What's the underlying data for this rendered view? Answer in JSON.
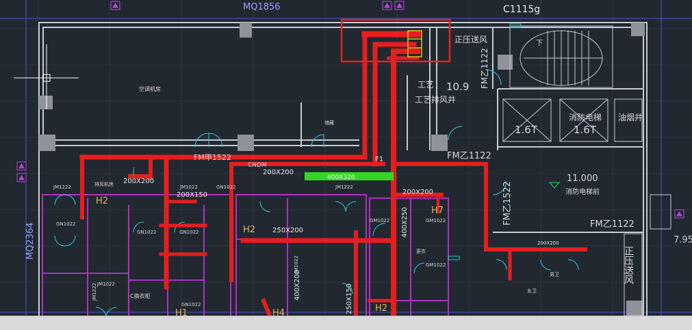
{
  "drawing": {
    "top_labels": {
      "left_dim": "MQ1856",
      "right_ref": "C1115g"
    },
    "left_dim": "MQ2364",
    "right_edge_dim": "7.95",
    "room_labels": {
      "positive_pressure_supply": "正压送风",
      "positive_pressure_supply_v": "正压送风",
      "ac_room": "空调机房",
      "process_exhaust": "工艺排风井",
      "process_exhaust_dim": "10.9",
      "fire_elevator_1": "1.6T",
      "fire_elevator_2": "1.6T",
      "fire_elevator_label": "消防电梯",
      "oil_smoke_shaft": "油烟井",
      "elevator_lobby": "消防电梯前",
      "elevator_level": "11.000",
      "stair_label": "下",
      "door_fm1522_top": "FM甲1522",
      "door_fm1522_right": "FM乙1522",
      "door_fm1122_a": "FM乙1122",
      "door_fm1122_b": "FM乙1122",
      "door_fm1122_c": "FM乙1122",
      "cnd": "CNDM",
      "room_office": "工艺",
      "jm1222_a": "JM1222",
      "jm1222_b": "JM1222",
      "jm1222_c": "JM1222",
      "gn1022_a": "GN1022",
      "gn1022_b": "GN1022",
      "gn1022_c": "GN1022",
      "gn1022_d": "GN1022",
      "gn1022_e": "GN1022",
      "gm1022_a": "GM1022",
      "gm1022_b": "GM1022",
      "gm1022_c": "GM1022",
      "jm1022_a": "JM1022",
      "jm1022_b": "JM1022",
      "jm1022_c": "JM1022",
      "storage": "储藏",
      "exhaust_room": "排风机房",
      "toilet_m": "男卫",
      "toilet_f": "女卫",
      "changing": "更衣",
      "c_label": "C换衣柜"
    },
    "duct_labels": {
      "d200x200_a": "200X200",
      "d200x200_b": "200X200",
      "d200x200_c": "200X200",
      "d200x200_d": "200X200",
      "d400x320": "400X320",
      "d250x200": "250X200",
      "d400x250": "400X250",
      "d400x200": "400X200",
      "d200x150": "200X150",
      "d250x150": "250X150"
    },
    "tags": {
      "h2_a": "H2",
      "h2_b": "H2",
      "h2_c": "H2",
      "h1": "H1",
      "h4": "H4",
      "h7": "H7",
      "f1": "F1"
    }
  }
}
